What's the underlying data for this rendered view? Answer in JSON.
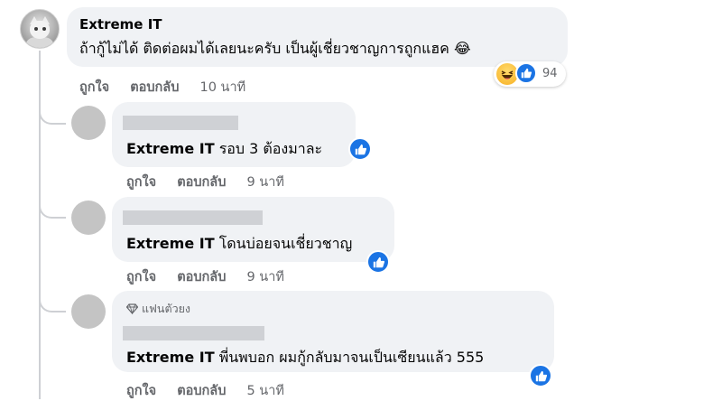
{
  "main_comment": {
    "author": "Extreme IT",
    "text": "ถ้ากู้ไม่ได้ ติดต่อผมได้เลยนะครับ เป็นผู้เชี่ยวชาญการถูกแฮค 😂",
    "reaction_count": "94",
    "like_label": "ถูกใจ",
    "reply_label": "ตอบกลับ",
    "time": "10 นาที",
    "reactions": [
      "haha-icon",
      "like-icon"
    ]
  },
  "replies": [
    {
      "mention": "Extreme IT",
      "text": " รอบ 3 ต้องมาละ",
      "like_label": "ถูกใจ",
      "reply_label": "ตอบกลับ",
      "time": "9 นาที",
      "badge": ""
    },
    {
      "mention": "Extreme IT",
      "text": " โดนบ่อยจนเชี่ยวชาญ",
      "like_label": "ถูกใจ",
      "reply_label": "ตอบกลับ",
      "time": "9 นาที",
      "badge": ""
    },
    {
      "mention": "Extreme IT",
      "text": " พี่นพบอก ผมกู้กลับมาจนเป็นเซียนแล้ว 555",
      "like_label": "ถูกใจ",
      "reply_label": "ตอบกลับ",
      "time": "5 นาที",
      "badge": "แฟนตัวยง"
    }
  ],
  "colors": {
    "bubble": "#f0f2f5",
    "meta_text": "#65676b",
    "like_blue": "#1b74e4",
    "thread_line": "#ced0d4"
  }
}
